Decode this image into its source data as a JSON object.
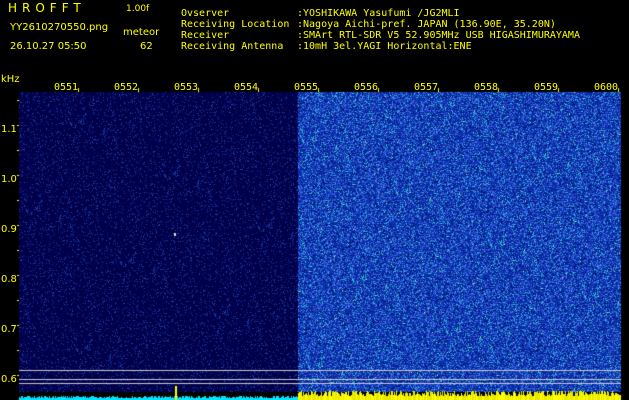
{
  "header": {
    "program": "HROFFT",
    "version": "1.00f",
    "filename": "YY2610270550.png",
    "datetime": "26.10.27 05:50",
    "meteor_label": "meteor",
    "meteor_count": "62"
  },
  "station": {
    "labels": [
      "Ovserver",
      "Receiving Location",
      "Receiver",
      "Receiving Antenna"
    ],
    "values": [
      ":YOSHIKAWA Yasufumi /JG2MLI",
      ":Nagoya Aichi-pref. JAPAN (136.90E, 35.20N)",
      ":SMArt RTL-SDR V5 52.905MHz USB HIGASHIMURAYAMA",
      ":10mH 3el.YAGI Horizontal:ENE"
    ]
  },
  "axis": {
    "unit": "kHz",
    "y_ticks": [
      "1.1",
      "1.0",
      "0.9",
      "0.8",
      "0.7",
      "0.6"
    ],
    "time_labels": [
      "0551",
      "0552",
      "0553",
      "0554",
      "0555",
      "0556",
      "0557",
      "0558",
      "0559",
      "0600"
    ]
  },
  "colors": {
    "text": "#ffff00",
    "background": "#000000",
    "quiet_band": "#00004a",
    "active_band": "#0a2fa8",
    "noise_bar": "#00e5ff"
  }
}
